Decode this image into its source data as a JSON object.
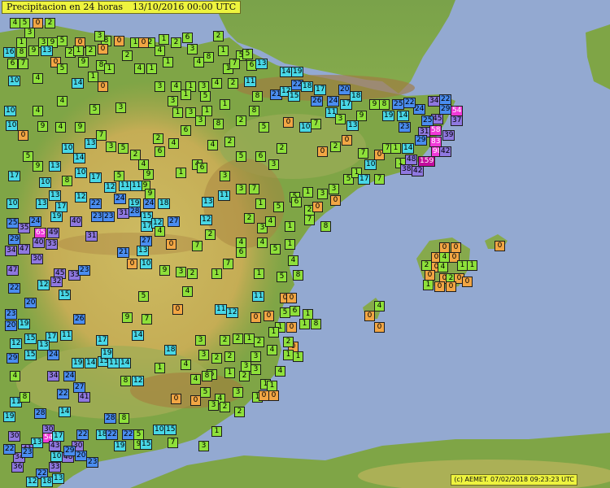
{
  "title": "Precipitacion en 24 horas",
  "date": "13/10/2016 00:00 UTC",
  "credit": "(c) AEMET. 07/02/2018 09:23:23 UTC",
  "colors": {
    "sea": "#93a9d1",
    "lowland": "#6aa33d",
    "plateau": "#c8b760",
    "mountain": "#a97b3b",
    "class_0": "#f2a644",
    "class_1_9": "#8ee03a",
    "class_10_19": "#48d7e6",
    "class_20_29": "#4a8df0",
    "class_30_49": "#8f78e0",
    "class_50_99": "#f03ad8",
    "class_100_plus": "#c20c9c"
  },
  "stations": [
    [
      4,
      12,
      22
    ],
    [
      5,
      24,
      22
    ],
    [
      0,
      40,
      22
    ],
    [
      2,
      55,
      22
    ],
    [
      3,
      30,
      34
    ],
    [
      1,
      20,
      46
    ],
    [
      3,
      47,
      46
    ],
    [
      9,
      58,
      46
    ],
    [
      5,
      70,
      44
    ],
    [
      8,
      20,
      58
    ],
    [
      9,
      35,
      56
    ],
    [
      13,
      50,
      56
    ],
    [
      6,
      9,
      72
    ],
    [
      7,
      22,
      72
    ],
    [
      0,
      62,
      70
    ],
    [
      10,
      10,
      93
    ],
    [
      4,
      40,
      90
    ],
    [
      14,
      88,
      96
    ],
    [
      0,
      120,
      100
    ],
    [
      10,
      5,
      130
    ],
    [
      4,
      40,
      130
    ],
    [
      0,
      22,
      160
    ],
    [
      9,
      46,
      149
    ],
    [
      10,
      7,
      148
    ],
    [
      0,
      92,
      46
    ],
    [
      2,
      80,
      58
    ],
    [
      1,
      90,
      56
    ],
    [
      2,
      105,
      56
    ],
    [
      9,
      96,
      70
    ],
    [
      8,
      118,
      74
    ],
    [
      1,
      128,
      78
    ],
    [
      5,
      70,
      78
    ],
    [
      1,
      108,
      88
    ],
    [
      3,
      142,
      126
    ],
    [
      4,
      70,
      118
    ],
    [
      5,
      110,
      128
    ],
    [
      2,
      150,
      62
    ],
    [
      4,
      165,
      78
    ],
    [
      1,
      180,
      78
    ],
    [
      4,
      190,
      56
    ],
    [
      1,
      195,
      42
    ],
    [
      2,
      178,
      46
    ],
    [
      1,
      200,
      70
    ],
    [
      2,
      210,
      46
    ],
    [
      6,
      224,
      40
    ],
    [
      3,
      230,
      54
    ],
    [
      4,
      238,
      70
    ],
    [
      2,
      262,
      38
    ],
    [
      1,
      268,
      56
    ],
    [
      8,
      250,
      64
    ],
    [
      1,
      274,
      78
    ],
    [
      5,
      290,
      62
    ],
    [
      6,
      303,
      74
    ],
    [
      3,
      190,
      100
    ],
    [
      4,
      210,
      100
    ],
    [
      1,
      228,
      100
    ],
    [
      3,
      244,
      100
    ],
    [
      4,
      260,
      96
    ],
    [
      2,
      280,
      96
    ],
    [
      3,
      206,
      118
    ],
    [
      1,
      222,
      110
    ],
    [
      5,
      246,
      112
    ],
    [
      1,
      212,
      132
    ],
    [
      3,
      228,
      132
    ],
    [
      1,
      248,
      130
    ],
    [
      1,
      270,
      122
    ],
    [
      8,
      124,
      44
    ],
    [
      0,
      140,
      44
    ],
    [
      1,
      160,
      46
    ],
    [
      3,
      116,
      38
    ],
    [
      0,
      120,
      54
    ],
    [
      0,
      170,
      46
    ],
    [
      9,
      92,
      150
    ],
    [
      13,
      104,
      170
    ],
    [
      14,
      90,
      188
    ],
    [
      10,
      76,
      176
    ],
    [
      4,
      68,
      150
    ],
    [
      7,
      118,
      160
    ],
    [
      3,
      130,
      174
    ],
    [
      5,
      145,
      176
    ],
    [
      2,
      160,
      184
    ],
    [
      5,
      140,
      210
    ],
    [
      4,
      170,
      196
    ],
    [
      6,
      190,
      180
    ],
    [
      2,
      188,
      164
    ],
    [
      4,
      207,
      170
    ],
    [
      4,
      236,
      196
    ],
    [
      1,
      216,
      206
    ],
    [
      9,
      176,
      208
    ],
    [
      9,
      172,
      222
    ],
    [
      6,
      242,
      200
    ],
    [
      3,
      270,
      210
    ],
    [
      5,
      290,
      186
    ],
    [
      6,
      314,
      186
    ],
    [
      3,
      330,
      196
    ],
    [
      2,
      340,
      176
    ],
    [
      4,
      255,
      172
    ],
    [
      2,
      276,
      168
    ],
    [
      6,
      222,
      154
    ],
    [
      3,
      240,
      142
    ],
    [
      8,
      262,
      146
    ],
    [
      2,
      290,
      142
    ],
    [
      8,
      306,
      130
    ],
    [
      5,
      318,
      150
    ],
    [
      0,
      348,
      144
    ],
    [
      10,
      368,
      150
    ],
    [
      7,
      382,
      146
    ],
    [
      0,
      390,
      180
    ],
    [
      2,
      406,
      174
    ],
    [
      0,
      420,
      166
    ],
    [
      7,
      440,
      182
    ],
    [
      0,
      460,
      184
    ],
    [
      7,
      470,
      176
    ],
    [
      1,
      480,
      176
    ],
    [
      13,
      60,
      198
    ],
    [
      10,
      48,
      218
    ],
    [
      8,
      76,
      216
    ],
    [
      13,
      60,
      234
    ],
    [
      17,
      10,
      210
    ],
    [
      10,
      8,
      244
    ],
    [
      5,
      28,
      186
    ],
    [
      9,
      40,
      198
    ],
    [
      13,
      44,
      244
    ],
    [
      10,
      92,
      206
    ],
    [
      17,
      110,
      212
    ],
    [
      12,
      128,
      224
    ],
    [
      11,
      146,
      222
    ],
    [
      11,
      160,
      222
    ],
    [
      9,
      178,
      232
    ],
    [
      17,
      68,
      248
    ],
    [
      12,
      92,
      236
    ],
    [
      22,
      110,
      244
    ],
    [
      24,
      140,
      238
    ],
    [
      19,
      158,
      244
    ],
    [
      24,
      176,
      244
    ],
    [
      18,
      194,
      244
    ],
    [
      13,
      248,
      242
    ],
    [
      11,
      268,
      234
    ],
    [
      3,
      290,
      226
    ],
    [
      7,
      306,
      226
    ],
    [
      1,
      314,
      244
    ],
    [
      2,
      300,
      262
    ],
    [
      3,
      316,
      274
    ],
    [
      4,
      326,
      266
    ],
    [
      5,
      336,
      248
    ],
    [
      5,
      356,
      236
    ],
    [
      1,
      372,
      230
    ],
    [
      6,
      358,
      242
    ],
    [
      2,
      374,
      252
    ],
    [
      7,
      374,
      264
    ],
    [
      8,
      394,
      272
    ],
    [
      1,
      350,
      272
    ],
    [
      4,
      316,
      292
    ],
    [
      5,
      332,
      300
    ],
    [
      1,
      350,
      294
    ],
    [
      3,
      390,
      232
    ],
    [
      0,
      384,
      248
    ],
    [
      0,
      406,
      240
    ],
    [
      3,
      404,
      226
    ],
    [
      5,
      422,
      214
    ],
    [
      1,
      432,
      206
    ],
    [
      17,
      440,
      214
    ],
    [
      7,
      460,
      214
    ],
    [
      10,
      448,
      196
    ],
    [
      1,
      486,
      194
    ],
    [
      14,
      494,
      176
    ],
    [
      48,
      498,
      190
    ],
    [
      38,
      492,
      202
    ],
    [
      42,
      506,
      204
    ],
    [
      159,
      514,
      192
    ],
    [
      98,
      530,
      180
    ],
    [
      83,
      528,
      168
    ],
    [
      39,
      544,
      160
    ],
    [
      42,
      540,
      180
    ],
    [
      31,
      514,
      156
    ],
    [
      58,
      528,
      154
    ],
    [
      45,
      530,
      140
    ],
    [
      37,
      554,
      142
    ],
    [
      29,
      510,
      166
    ],
    [
      54,
      554,
      130
    ],
    [
      29,
      540,
      128
    ],
    [
      24,
      508,
      128
    ],
    [
      25,
      518,
      142
    ],
    [
      22,
      496,
      120
    ],
    [
      34,
      526,
      118
    ],
    [
      22,
      540,
      116
    ],
    [
      16,
      4,
      58
    ],
    [
      22,
      358,
      98
    ],
    [
      26,
      382,
      118
    ],
    [
      24,
      402,
      118
    ],
    [
      17,
      418,
      122
    ],
    [
      18,
      430,
      112
    ],
    [
      11,
      400,
      132
    ],
    [
      3,
      412,
      140
    ],
    [
      13,
      426,
      148
    ],
    [
      20,
      416,
      104
    ],
    [
      18,
      370,
      100
    ],
    [
      17,
      386,
      104
    ],
    [
      9,
      454,
      122
    ],
    [
      8,
      466,
      122
    ],
    [
      25,
      482,
      122
    ],
    [
      14,
      488,
      136
    ],
    [
      23,
      490,
      150
    ],
    [
      19,
      470,
      136
    ],
    [
      9,
      438,
      136
    ],
    [
      21,
      332,
      110
    ],
    [
      12,
      344,
      106
    ],
    [
      15,
      354,
      112
    ],
    [
      14,
      344,
      82
    ],
    [
      19,
      358,
      82
    ],
    [
      13,
      314,
      72
    ],
    [
      5,
      298,
      60
    ],
    [
      7,
      282,
      72
    ],
    [
      11,
      300,
      94
    ],
    [
      8,
      310,
      112
    ],
    [
      25,
      8,
      268
    ],
    [
      24,
      36,
      266
    ],
    [
      19,
      62,
      260
    ],
    [
      35,
      22,
      274
    ],
    [
      29,
      10,
      288
    ],
    [
      40,
      40,
      292
    ],
    [
      65,
      42,
      280
    ],
    [
      49,
      58,
      280
    ],
    [
      33,
      56,
      294
    ],
    [
      40,
      86,
      266
    ],
    [
      31,
      105,
      284
    ],
    [
      23,
      112,
      260
    ],
    [
      23,
      126,
      260
    ],
    [
      31,
      144,
      256
    ],
    [
      28,
      158,
      254
    ],
    [
      15,
      173,
      260
    ],
    [
      17,
      173,
      272
    ],
    [
      12,
      186,
      268
    ],
    [
      27,
      206,
      266
    ],
    [
      12,
      246,
      264
    ],
    [
      4,
      190,
      278
    ],
    [
      34,
      6,
      302
    ],
    [
      47,
      22,
      300
    ],
    [
      30,
      38,
      312
    ],
    [
      47,
      8,
      326
    ],
    [
      45,
      66,
      330
    ],
    [
      32,
      62,
      340
    ],
    [
      33,
      84,
      332
    ],
    [
      21,
      144,
      304
    ],
    [
      27,
      172,
      290
    ],
    [
      13,
      168,
      302
    ],
    [
      0,
      204,
      294
    ],
    [
      7,
      236,
      296
    ],
    [
      4,
      290,
      292
    ],
    [
      6,
      290,
      304
    ],
    [
      2,
      252,
      282
    ],
    [
      22,
      10,
      348
    ],
    [
      20,
      30,
      366
    ],
    [
      12,
      46,
      344
    ],
    [
      15,
      72,
      356
    ],
    [
      23,
      96,
      326
    ],
    [
      9,
      196,
      326
    ],
    [
      3,
      216,
      328
    ],
    [
      2,
      230,
      330
    ],
    [
      1,
      260,
      330
    ],
    [
      7,
      274,
      318
    ],
    [
      0,
      156,
      318
    ],
    [
      10,
      172,
      318
    ],
    [
      5,
      170,
      358
    ],
    [
      4,
      224,
      352
    ],
    [
      0,
      212,
      374
    ],
    [
      11,
      264,
      374
    ],
    [
      12,
      278,
      378
    ],
    [
      1,
      312,
      330
    ],
    [
      11,
      310,
      358
    ],
    [
      5,
      340,
      334
    ],
    [
      4,
      354,
      314
    ],
    [
      8,
      360,
      332
    ],
    [
      0,
      344,
      360
    ],
    [
      0,
      352,
      360
    ],
    [
      0,
      324,
      382
    ],
    [
      0,
      308,
      384
    ],
    [
      5,
      344,
      378
    ],
    [
      6,
      356,
      376
    ],
    [
      1,
      372,
      380
    ],
    [
      8,
      382,
      392
    ],
    [
      1,
      368,
      392
    ],
    [
      0,
      352,
      396
    ],
    [
      1,
      338,
      396
    ],
    [
      0,
      354,
      420
    ],
    [
      0,
      540,
      298
    ],
    [
      0,
      554,
      298
    ],
    [
      0,
      530,
      310
    ],
    [
      4,
      540,
      310
    ],
    [
      0,
      552,
      310
    ],
    [
      2,
      518,
      320
    ],
    [
      0,
      530,
      322
    ],
    [
      4,
      538,
      322
    ],
    [
      1,
      562,
      320
    ],
    [
      1,
      574,
      320
    ],
    [
      0,
      522,
      332
    ],
    [
      0,
      540,
      336
    ],
    [
      2,
      548,
      336
    ],
    [
      0,
      558,
      336
    ],
    [
      0,
      568,
      340
    ],
    [
      1,
      520,
      344
    ],
    [
      0,
      534,
      346
    ],
    [
      0,
      548,
      346
    ],
    [
      0,
      608,
      296
    ],
    [
      4,
      460,
      370
    ],
    [
      0,
      448,
      382
    ],
    [
      0,
      460,
      396
    ],
    [
      23,
      6,
      380
    ],
    [
      20,
      6,
      394
    ],
    [
      19,
      22,
      392
    ],
    [
      12,
      12,
      416
    ],
    [
      26,
      90,
      386
    ],
    [
      17,
      118,
      412
    ],
    [
      9,
      150,
      384
    ],
    [
      7,
      174,
      386
    ],
    [
      14,
      162,
      406
    ],
    [
      15,
      30,
      410
    ],
    [
      17,
      56,
      408
    ],
    [
      11,
      74,
      406
    ],
    [
      13,
      46,
      418
    ],
    [
      29,
      8,
      434
    ],
    [
      15,
      30,
      430
    ],
    [
      24,
      58,
      430
    ],
    [
      18,
      202,
      424
    ],
    [
      3,
      240,
      412
    ],
    [
      2,
      270,
      412
    ],
    [
      2,
      286,
      410
    ],
    [
      1,
      300,
      410
    ],
    [
      1,
      330,
      402
    ],
    [
      2,
      312,
      414
    ],
    [
      2,
      348,
      414
    ],
    [
      4,
      328,
      424
    ],
    [
      1,
      348,
      430
    ],
    [
      1,
      360,
      432
    ],
    [
      4,
      338,
      450
    ],
    [
      3,
      308,
      432
    ],
    [
      2,
      276,
      432
    ],
    [
      2,
      260,
      434
    ],
    [
      3,
      244,
      430
    ],
    [
      4,
      222,
      442
    ],
    [
      6,
      254,
      454
    ],
    [
      1,
      276,
      452
    ],
    [
      3,
      296,
      444
    ],
    [
      3,
      308,
      448
    ],
    [
      2,
      294,
      456
    ],
    [
      1,
      320,
      466
    ],
    [
      1,
      328,
      468
    ],
    [
      3,
      286,
      476
    ],
    [
      1,
      310,
      482
    ],
    [
      0,
      318,
      480
    ],
    [
      0,
      330,
      480
    ],
    [
      8,
      248,
      456
    ],
    [
      4,
      234,
      460
    ],
    [
      5,
      246,
      476
    ],
    [
      4,
      264,
      484
    ],
    [
      2,
      270,
      494
    ],
    [
      3,
      256,
      492
    ],
    [
      0,
      234,
      486
    ],
    [
      4,
      12,
      456
    ],
    [
      34,
      58,
      456
    ],
    [
      24,
      78,
      456
    ],
    [
      19,
      88,
      440
    ],
    [
      14,
      104,
      440
    ],
    [
      15,
      120,
      438
    ],
    [
      19,
      124,
      428
    ],
    [
      11,
      132,
      440
    ],
    [
      14,
      146,
      440
    ],
    [
      8,
      148,
      462
    ],
    [
      12,
      162,
      462
    ],
    [
      1,
      190,
      446
    ],
    [
      27,
      90,
      470
    ],
    [
      41,
      96,
      482
    ],
    [
      22,
      70,
      478
    ],
    [
      14,
      72,
      500
    ],
    [
      11,
      12,
      488
    ],
    [
      8,
      24,
      482
    ],
    [
      28,
      42,
      502
    ],
    [
      28,
      128,
      508
    ],
    [
      8,
      146,
      508
    ],
    [
      0,
      210,
      484
    ],
    [
      2,
      288,
      500
    ],
    [
      22,
      94,
      528
    ],
    [
      18,
      118,
      528
    ],
    [
      22,
      130,
      528
    ],
    [
      22,
      150,
      528
    ],
    [
      19,
      4,
      506
    ],
    [
      30,
      10,
      530
    ],
    [
      30,
      52,
      522
    ],
    [
      54,
      52,
      532
    ],
    [
      17,
      64,
      530
    ],
    [
      13,
      38,
      538
    ],
    [
      43,
      60,
      542
    ],
    [
      30,
      88,
      542
    ],
    [
      48,
      76,
      556
    ],
    [
      20,
      92,
      554
    ],
    [
      23,
      106,
      562
    ],
    [
      34,
      16,
      556
    ],
    [
      36,
      14,
      568
    ],
    [
      33,
      60,
      568
    ],
    [
      22,
      44,
      576
    ],
    [
      12,
      32,
      586
    ],
    [
      18,
      50,
      592
    ],
    [
      13,
      64,
      582
    ],
    [
      41,
      26,
      546
    ],
    [
      29,
      78,
      548
    ],
    [
      22,
      4,
      546
    ],
    [
      9,
      164,
      540
    ],
    [
      15,
      172,
      540
    ],
    [
      10,
      188,
      522
    ],
    [
      15,
      202,
      522
    ],
    [
      7,
      206,
      538
    ],
    [
      3,
      244,
      542
    ],
    [
      1,
      260,
      524
    ],
    [
      23,
      26,
      550
    ],
    [
      10,
      62,
      555
    ],
    [
      19,
      140,
      542
    ],
    [
      5,
      164,
      528
    ]
  ]
}
